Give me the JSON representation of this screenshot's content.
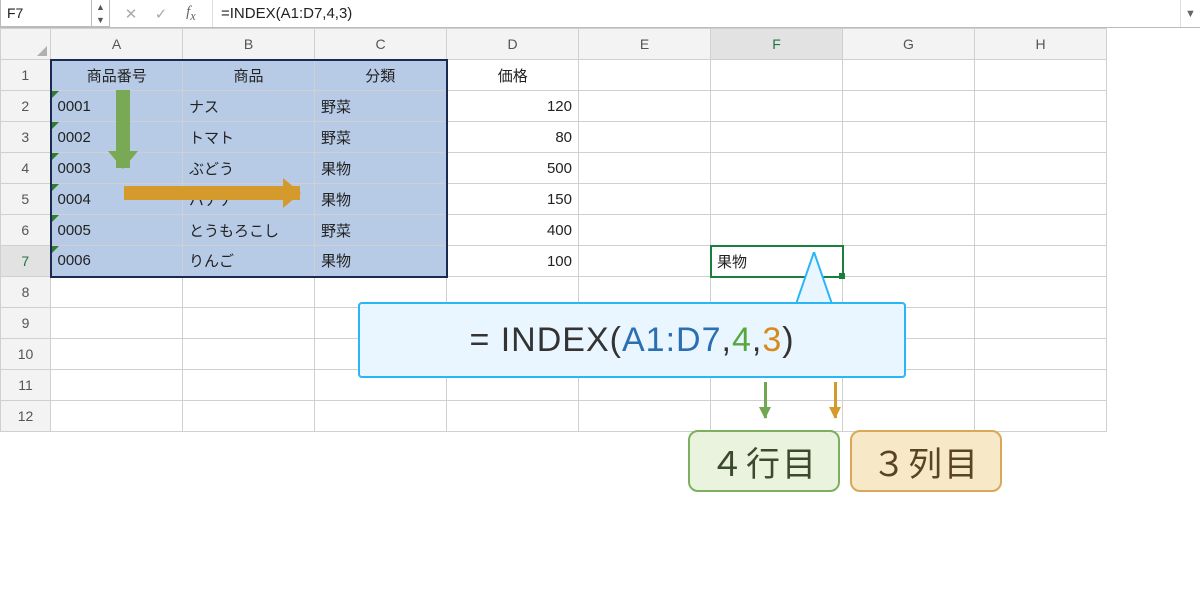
{
  "name_box": "F7",
  "formula": "=INDEX(A1:D7,4,3)",
  "columns": [
    "A",
    "B",
    "C",
    "D",
    "E",
    "F",
    "G",
    "H"
  ],
  "rows": [
    "1",
    "2",
    "3",
    "4",
    "5",
    "6",
    "7",
    "8",
    "9",
    "10",
    "11",
    "12"
  ],
  "headers": {
    "A": "商品番号",
    "B": "商品",
    "C": "分類",
    "D": "価格"
  },
  "data": [
    {
      "id": "0001",
      "name": "ナス",
      "cat": "野菜",
      "price": "120"
    },
    {
      "id": "0002",
      "name": "トマト",
      "cat": "野菜",
      "price": "80"
    },
    {
      "id": "0003",
      "name": "ぶどう",
      "cat": "果物",
      "price": "500"
    },
    {
      "id": "0004",
      "name": "バナナ",
      "cat": "果物",
      "price": "150"
    },
    {
      "id": "0005",
      "name": "とうもろこし",
      "cat": "野菜",
      "price": "400"
    },
    {
      "id": "0006",
      "name": "りんご",
      "cat": "果物",
      "price": "100"
    }
  ],
  "active_value": "果物",
  "callout": {
    "eq": "= INDEX( ",
    "range": "A1:D7",
    "comma": " , ",
    "row": "4",
    "col": "3",
    "close": " )"
  },
  "labels": {
    "row": "４行目",
    "col": "３列目"
  }
}
